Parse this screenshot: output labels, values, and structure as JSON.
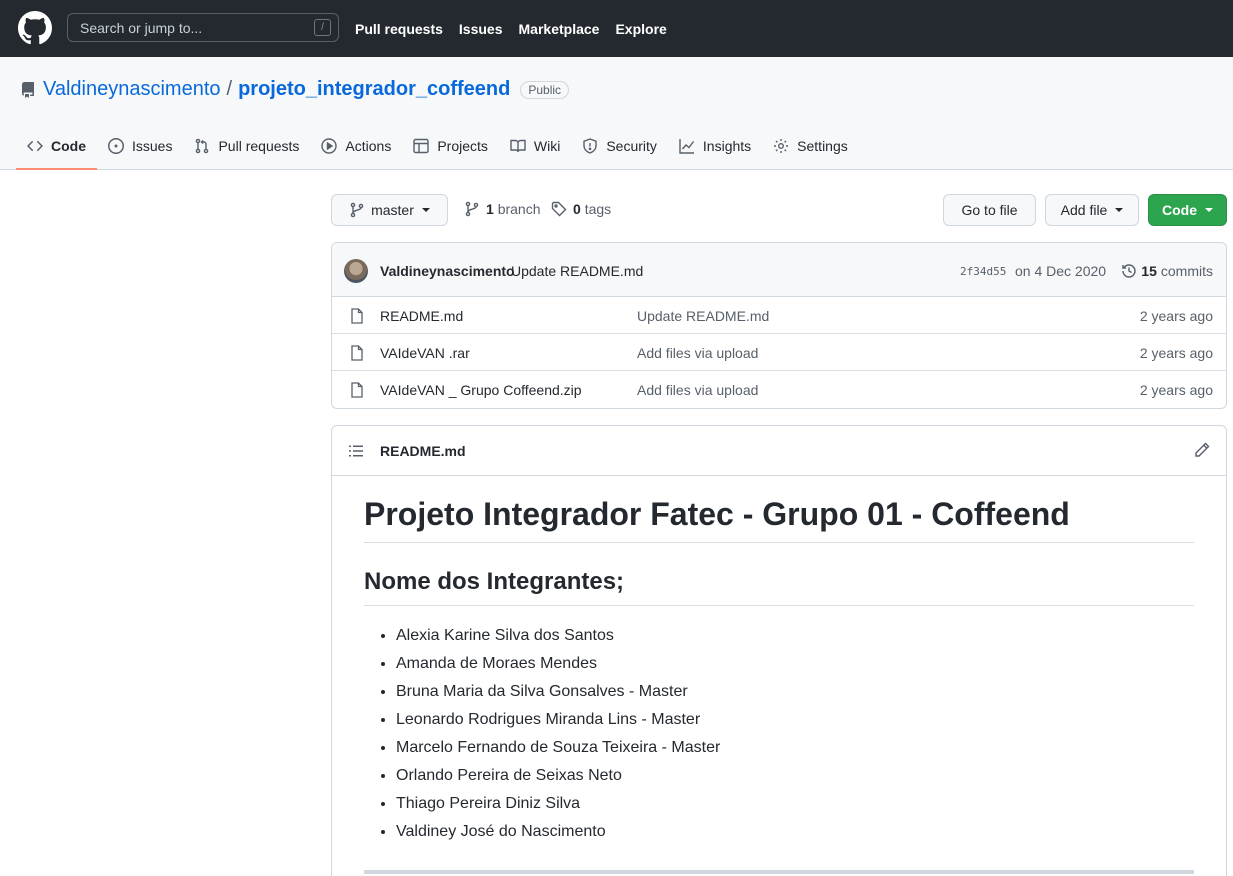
{
  "topbar": {
    "search_placeholder": "Search or jump to...",
    "search_shortcut": "/",
    "nav": [
      "Pull requests",
      "Issues",
      "Marketplace",
      "Explore"
    ]
  },
  "repo": {
    "owner": "Valdineynascimento",
    "separator": "/",
    "name": "projeto_integrador_coffeend",
    "visibility": "Public"
  },
  "tabs": {
    "code": "Code",
    "issues": "Issues",
    "pulls": "Pull requests",
    "actions": "Actions",
    "projects": "Projects",
    "wiki": "Wiki",
    "security": "Security",
    "insights": "Insights",
    "settings": "Settings"
  },
  "branchbar": {
    "branch": "master",
    "branch_count": "1",
    "branch_label": "branch",
    "tag_count": "0",
    "tag_label": "tags",
    "goto_file": "Go to file",
    "add_file": "Add file",
    "code": "Code"
  },
  "latest_commit": {
    "author": "Valdineynascimento",
    "message": "Update README.md",
    "sha": "2f34d55",
    "date": "on 4 Dec 2020",
    "count": "15",
    "count_label": "commits"
  },
  "files": [
    {
      "name": "README.md",
      "message": "Update README.md",
      "age": "2 years ago"
    },
    {
      "name": "VAIdeVAN .rar",
      "message": "Add files via upload",
      "age": "2 years ago"
    },
    {
      "name": "VAIdeVAN _ Grupo Coffeend.zip",
      "message": "Add files via upload",
      "age": "2 years ago"
    }
  ],
  "readme": {
    "filename": "README.md",
    "title": "Projeto Integrador Fatec - Grupo 01 - Coffeend",
    "subtitle": "Nome dos Integrantes;",
    "members": [
      "Alexia Karine Silva dos Santos",
      "Amanda de Moraes Mendes",
      "Bruna Maria da Silva Gonsalves - Master",
      "Leonardo Rodrigues Miranda Lins - Master",
      "Marcelo Fernando de Souza Teixeira - Master",
      "Orlando Pereira de Seixas Neto",
      "Thiago Pereira Diniz Silva",
      "Valdiney José do Nascimento"
    ]
  },
  "colors": {
    "header_bg": "#24292f",
    "link": "#0969da",
    "primary_button": "#2da44e",
    "active_tab_underline": "#fd8c73"
  }
}
